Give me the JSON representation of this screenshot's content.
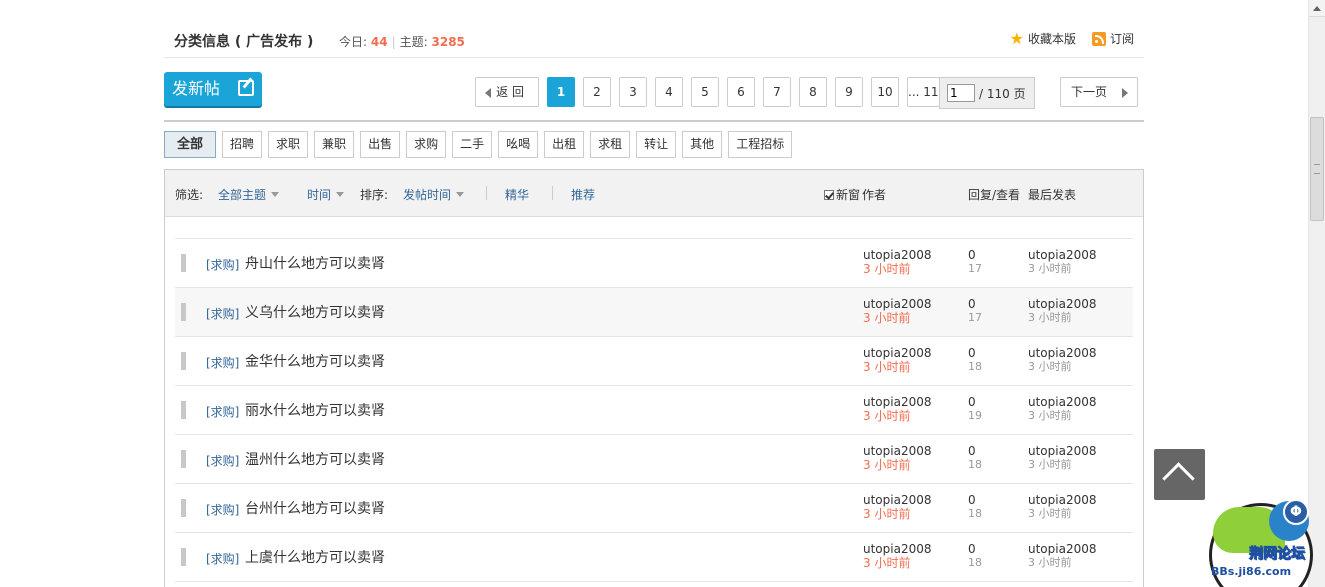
{
  "header": {
    "title": "分类信息 ( 广告发布 )",
    "today_label": "今日:",
    "today_count": "44",
    "topics_label": "主题:",
    "topics_count": "3285",
    "favorite_label": "收藏本版",
    "subscribe_label": "订阅"
  },
  "new_post_label": "发新帖",
  "pager": {
    "back_label": "返 回",
    "pages": [
      "1",
      "2",
      "3",
      "4",
      "5",
      "6",
      "7",
      "8",
      "9",
      "10",
      "... 11"
    ],
    "current_page": "1",
    "jump_value": "1",
    "total_label": "/ 110 页",
    "next_label": "下一页"
  },
  "categories": [
    "全部",
    "招聘",
    "求职",
    "兼职",
    "出售",
    "求购",
    "二手",
    "吆喝",
    "出租",
    "求租",
    "转让",
    "其他",
    "工程招标"
  ],
  "filter": {
    "filter_label": "筛选:",
    "all_topics": "全部主题",
    "time": "时间",
    "sort_label": "排序:",
    "post_time": "发帖时间",
    "digest": "精华",
    "recommend": "推荐",
    "new_window": "新窗",
    "author_col": "作者",
    "reply_view_col": "回复/查看",
    "last_post_col": "最后发表"
  },
  "threads": [
    {
      "tag": "[求购]",
      "title": "舟山什么地方可以卖肾",
      "author": "utopia2008",
      "author_time": "3 小时前",
      "replies": "0",
      "views": "17",
      "last_author": "utopia2008",
      "last_time": "3 小时前"
    },
    {
      "tag": "[求购]",
      "title": "义乌什么地方可以卖肾",
      "author": "utopia2008",
      "author_time": "3 小时前",
      "replies": "0",
      "views": "17",
      "last_author": "utopia2008",
      "last_time": "3 小时前"
    },
    {
      "tag": "[求购]",
      "title": "金华什么地方可以卖肾",
      "author": "utopia2008",
      "author_time": "3 小时前",
      "replies": "0",
      "views": "18",
      "last_author": "utopia2008",
      "last_time": "3 小时前"
    },
    {
      "tag": "[求购]",
      "title": "丽水什么地方可以卖肾",
      "author": "utopia2008",
      "author_time": "3 小时前",
      "replies": "0",
      "views": "19",
      "last_author": "utopia2008",
      "last_time": "3 小时前"
    },
    {
      "tag": "[求购]",
      "title": "温州什么地方可以卖肾",
      "author": "utopia2008",
      "author_time": "3 小时前",
      "replies": "0",
      "views": "18",
      "last_author": "utopia2008",
      "last_time": "3 小时前"
    },
    {
      "tag": "[求购]",
      "title": "台州什么地方可以卖肾",
      "author": "utopia2008",
      "author_time": "3 小时前",
      "replies": "0",
      "views": "18",
      "last_author": "utopia2008",
      "last_time": "3 小时前"
    },
    {
      "tag": "[求购]",
      "title": "上虞什么地方可以卖肾",
      "author": "utopia2008",
      "author_time": "3 小时前",
      "replies": "0",
      "views": "18",
      "last_author": "utopia2008",
      "last_time": "3 小时前"
    }
  ],
  "mascot": {
    "badge": "Φ",
    "brand": "荆网论坛",
    "url": "BBs.ji86.com"
  },
  "colors": {
    "accent": "#1aa4d8",
    "count": "#f26c4f",
    "link": "#336699"
  }
}
